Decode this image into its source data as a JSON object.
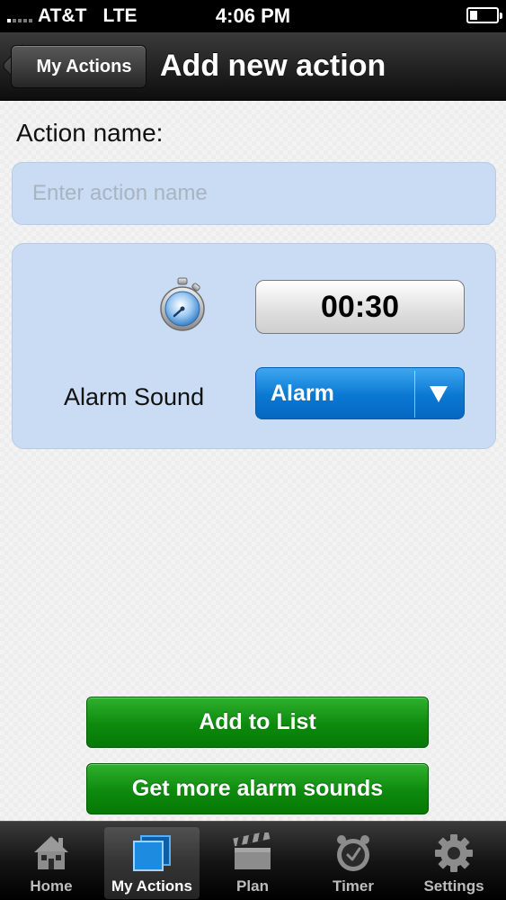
{
  "status_bar": {
    "carrier": "AT&T",
    "network": "LTE",
    "time": "4:06 PM",
    "signal_bars_filled": 1,
    "battery_level": 0.3
  },
  "nav": {
    "back_label": "My Actions",
    "title": "Add new action"
  },
  "form": {
    "name_label": "Action name:",
    "name_placeholder": "Enter action name",
    "name_value": "",
    "duration": "00:30",
    "alarm_label": "Alarm Sound",
    "alarm_selected": "Alarm"
  },
  "buttons": {
    "add_to_list": "Add to List",
    "get_more_sounds": "Get more alarm sounds"
  },
  "tab_bar": {
    "tabs": [
      {
        "label": "Home",
        "icon": "house-icon"
      },
      {
        "label": "My Actions",
        "icon": "stacked-cards-icon"
      },
      {
        "label": "Plan",
        "icon": "clapperboard-icon"
      },
      {
        "label": "Timer",
        "icon": "clock-icon"
      },
      {
        "label": "Settings",
        "icon": "gear-icon"
      }
    ],
    "active": "My Actions"
  },
  "colors": {
    "panel_blue": "#c9dcf3",
    "select_blue": "#0a78d2",
    "button_green": "#0d8a0d"
  }
}
